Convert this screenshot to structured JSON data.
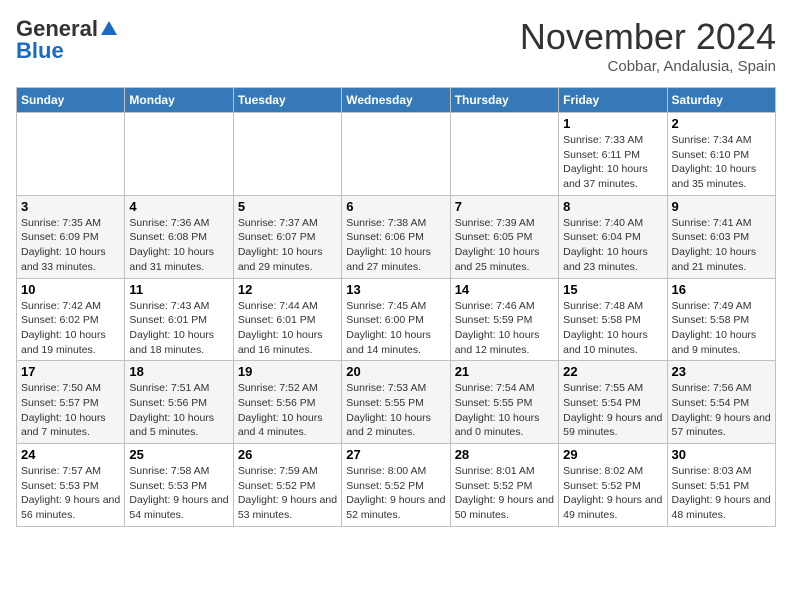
{
  "logo": {
    "general": "General",
    "blue": "Blue"
  },
  "header": {
    "month": "November 2024",
    "location": "Cobbar, Andalusia, Spain"
  },
  "weekdays": [
    "Sunday",
    "Monday",
    "Tuesday",
    "Wednesday",
    "Thursday",
    "Friday",
    "Saturday"
  ],
  "weeks": [
    [
      {
        "day": "",
        "info": ""
      },
      {
        "day": "",
        "info": ""
      },
      {
        "day": "",
        "info": ""
      },
      {
        "day": "",
        "info": ""
      },
      {
        "day": "",
        "info": ""
      },
      {
        "day": "1",
        "info": "Sunrise: 7:33 AM\nSunset: 6:11 PM\nDaylight: 10 hours and 37 minutes."
      },
      {
        "day": "2",
        "info": "Sunrise: 7:34 AM\nSunset: 6:10 PM\nDaylight: 10 hours and 35 minutes."
      }
    ],
    [
      {
        "day": "3",
        "info": "Sunrise: 7:35 AM\nSunset: 6:09 PM\nDaylight: 10 hours and 33 minutes."
      },
      {
        "day": "4",
        "info": "Sunrise: 7:36 AM\nSunset: 6:08 PM\nDaylight: 10 hours and 31 minutes."
      },
      {
        "day": "5",
        "info": "Sunrise: 7:37 AM\nSunset: 6:07 PM\nDaylight: 10 hours and 29 minutes."
      },
      {
        "day": "6",
        "info": "Sunrise: 7:38 AM\nSunset: 6:06 PM\nDaylight: 10 hours and 27 minutes."
      },
      {
        "day": "7",
        "info": "Sunrise: 7:39 AM\nSunset: 6:05 PM\nDaylight: 10 hours and 25 minutes."
      },
      {
        "day": "8",
        "info": "Sunrise: 7:40 AM\nSunset: 6:04 PM\nDaylight: 10 hours and 23 minutes."
      },
      {
        "day": "9",
        "info": "Sunrise: 7:41 AM\nSunset: 6:03 PM\nDaylight: 10 hours and 21 minutes."
      }
    ],
    [
      {
        "day": "10",
        "info": "Sunrise: 7:42 AM\nSunset: 6:02 PM\nDaylight: 10 hours and 19 minutes."
      },
      {
        "day": "11",
        "info": "Sunrise: 7:43 AM\nSunset: 6:01 PM\nDaylight: 10 hours and 18 minutes."
      },
      {
        "day": "12",
        "info": "Sunrise: 7:44 AM\nSunset: 6:01 PM\nDaylight: 10 hours and 16 minutes."
      },
      {
        "day": "13",
        "info": "Sunrise: 7:45 AM\nSunset: 6:00 PM\nDaylight: 10 hours and 14 minutes."
      },
      {
        "day": "14",
        "info": "Sunrise: 7:46 AM\nSunset: 5:59 PM\nDaylight: 10 hours and 12 minutes."
      },
      {
        "day": "15",
        "info": "Sunrise: 7:48 AM\nSunset: 5:58 PM\nDaylight: 10 hours and 10 minutes."
      },
      {
        "day": "16",
        "info": "Sunrise: 7:49 AM\nSunset: 5:58 PM\nDaylight: 10 hours and 9 minutes."
      }
    ],
    [
      {
        "day": "17",
        "info": "Sunrise: 7:50 AM\nSunset: 5:57 PM\nDaylight: 10 hours and 7 minutes."
      },
      {
        "day": "18",
        "info": "Sunrise: 7:51 AM\nSunset: 5:56 PM\nDaylight: 10 hours and 5 minutes."
      },
      {
        "day": "19",
        "info": "Sunrise: 7:52 AM\nSunset: 5:56 PM\nDaylight: 10 hours and 4 minutes."
      },
      {
        "day": "20",
        "info": "Sunrise: 7:53 AM\nSunset: 5:55 PM\nDaylight: 10 hours and 2 minutes."
      },
      {
        "day": "21",
        "info": "Sunrise: 7:54 AM\nSunset: 5:55 PM\nDaylight: 10 hours and 0 minutes."
      },
      {
        "day": "22",
        "info": "Sunrise: 7:55 AM\nSunset: 5:54 PM\nDaylight: 9 hours and 59 minutes."
      },
      {
        "day": "23",
        "info": "Sunrise: 7:56 AM\nSunset: 5:54 PM\nDaylight: 9 hours and 57 minutes."
      }
    ],
    [
      {
        "day": "24",
        "info": "Sunrise: 7:57 AM\nSunset: 5:53 PM\nDaylight: 9 hours and 56 minutes."
      },
      {
        "day": "25",
        "info": "Sunrise: 7:58 AM\nSunset: 5:53 PM\nDaylight: 9 hours and 54 minutes."
      },
      {
        "day": "26",
        "info": "Sunrise: 7:59 AM\nSunset: 5:52 PM\nDaylight: 9 hours and 53 minutes."
      },
      {
        "day": "27",
        "info": "Sunrise: 8:00 AM\nSunset: 5:52 PM\nDaylight: 9 hours and 52 minutes."
      },
      {
        "day": "28",
        "info": "Sunrise: 8:01 AM\nSunset: 5:52 PM\nDaylight: 9 hours and 50 minutes."
      },
      {
        "day": "29",
        "info": "Sunrise: 8:02 AM\nSunset: 5:52 PM\nDaylight: 9 hours and 49 minutes."
      },
      {
        "day": "30",
        "info": "Sunrise: 8:03 AM\nSunset: 5:51 PM\nDaylight: 9 hours and 48 minutes."
      }
    ]
  ]
}
